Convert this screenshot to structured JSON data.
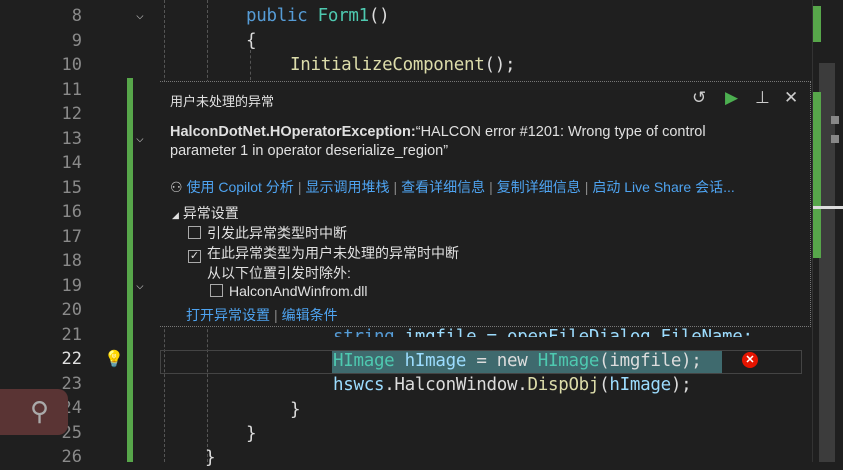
{
  "line_numbers": [
    "8",
    "9",
    "10",
    "11",
    "12",
    "13",
    "14",
    "15",
    "16",
    "17",
    "18",
    "19",
    "20",
    "21",
    "22",
    "23",
    "24",
    "25",
    "26"
  ],
  "code": {
    "l8_kw": "public",
    "l8_fn": "Form1",
    "l8_rest": "()",
    "l9": "{",
    "l10_fn": "InitializeComponent",
    "l10_rest": "();",
    "l21_kw": "string",
    "l21_rest": " imgfile = openFileDialog.FileName;",
    "l22_ty": "HImage",
    "l22_var": "hImage",
    "l22_mid": " = new ",
    "l22_ty2": "HImage",
    "l22_rest": "(imgfile);",
    "l23_var": "hswcs",
    "l23_a": ".HalconWindow.",
    "l23_fn": "DispObj",
    "l23_b": "(",
    "l23_var2": "hImage",
    "l23_c": ");",
    "l24": "}",
    "l25": "}",
    "l26": "}"
  },
  "popup": {
    "title": "用户未处理的异常",
    "exception_type": "HalconDotNet.HOperatorException:",
    "message_line1": "“HALCON error #1201: Wrong type of control",
    "message_line2": "parameter 1 in operator deserialize_region”",
    "links": [
      "使用 Copilot 分析",
      "显示调用堆栈",
      "查看详细信息",
      "复制详细信息",
      "启动 Live Share 会话..."
    ],
    "settings_header": "异常设置",
    "opt1": "引发此异常类型时中断",
    "opt1_checked": false,
    "opt2": "在此异常类型为用户未处理的异常时中断",
    "opt2_checked": true,
    "except_label": "从以下位置引发时除外:",
    "module": "HalconAndWinfrom.dll",
    "module_checked": false,
    "bottom_links": [
      "打开异常设置",
      "编辑条件"
    ],
    "check_mark": "✓"
  },
  "colors": {
    "accent_green": "#57a64a",
    "link": "#4ea3f0",
    "error": "#e51400"
  }
}
